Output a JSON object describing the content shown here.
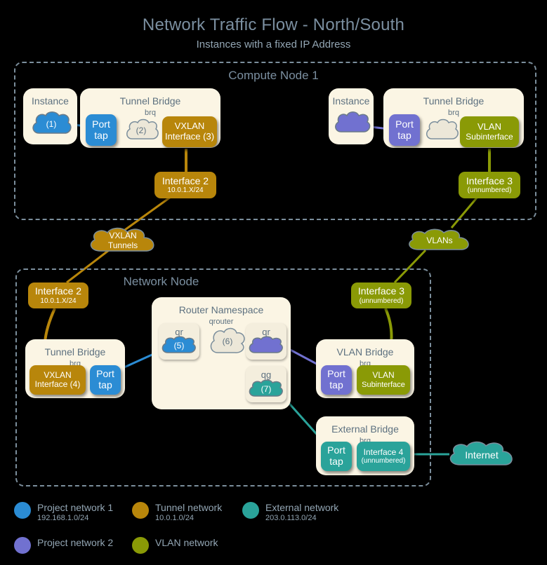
{
  "title": "Network Traffic Flow - North/South",
  "subtitle": "Instances with a fixed IP Address",
  "colors": {
    "project1": "#2b8cd4",
    "project2": "#7171d0",
    "tunnel": "#b8860b",
    "vlan": "#8a9a06",
    "external": "#2aa39a",
    "panel": "#fbf5e4",
    "cloud_neutral": "#ece7d8",
    "border": "#7b8e9c",
    "background": "#000000"
  },
  "zones": {
    "compute": {
      "title": "Compute Node 1"
    },
    "network": {
      "title": "Network Node"
    }
  },
  "compute_left": {
    "instance_panel": {
      "title": "Instance"
    },
    "instance_cloud": {
      "label": "(1)"
    },
    "bridge_panel": {
      "title": "Tunnel Bridge",
      "subtitle": "brq"
    },
    "port_tap": {
      "l1": "Port",
      "l2": "tap"
    },
    "bridge_cloud": {
      "label": "(2)"
    },
    "vxlan_iface": {
      "l1": "VXLAN",
      "l2": "Interface (3)"
    },
    "interface2": {
      "l1": "Interface 2",
      "l2": "10.0.1.X/24"
    }
  },
  "compute_right": {
    "instance_panel": {
      "title": "Instance"
    },
    "bridge_panel": {
      "title": "Tunnel Bridge",
      "subtitle": "brq"
    },
    "port_tap": {
      "l1": "Port",
      "l2": "tap"
    },
    "vlan_sub": {
      "l1": "VLAN",
      "l2": "Subinterface"
    },
    "interface3": {
      "l1": "Interface 3",
      "l2": "(unnumbered)"
    }
  },
  "transit": {
    "vxlan_cloud": {
      "l1": "VXLAN",
      "l2": "Tunnels"
    },
    "vlan_cloud": {
      "l1": "VLANs"
    }
  },
  "network_node": {
    "interface2": {
      "l1": "Interface 2",
      "l2": "10.0.1.X/24"
    },
    "interface3": {
      "l1": "Interface 3",
      "l2": "(unnumbered)"
    },
    "tunnel_bridge": {
      "title": "Tunnel Bridge",
      "subtitle": "brq"
    },
    "tunnel_vxlan_iface": {
      "l1": "VXLAN",
      "l2": "Interface (4)"
    },
    "tunnel_port_tap": {
      "l1": "Port",
      "l2": "tap"
    },
    "router_ns": {
      "title": "Router Namespace",
      "subtitle": "qrouter"
    },
    "qr_left": {
      "label": "qr",
      "cloud": "(5)"
    },
    "router_cloud": {
      "label": "(6)"
    },
    "qr_right": {
      "label": "qr",
      "cloud": ""
    },
    "qg": {
      "label": "qg",
      "cloud": "(7)"
    },
    "vlan_bridge": {
      "title": "VLAN Bridge",
      "subtitle": "brq"
    },
    "vlan_port_tap": {
      "l1": "Port",
      "l2": "tap"
    },
    "vlan_sub": {
      "l1": "VLAN",
      "l2": "Subinterface"
    },
    "external_bridge": {
      "title": "External Bridge",
      "subtitle": "brq"
    },
    "external_port_tap": {
      "l1": "Port",
      "l2": "tap"
    },
    "interface4": {
      "l1": "Interface 4",
      "l2": "(unnumbered)"
    }
  },
  "internet": {
    "label": "Internet"
  },
  "legend": [
    {
      "color": "#2b8cd4",
      "name": "Project network 1",
      "subnet": "192.168.1.0/24"
    },
    {
      "color": "#7171d0",
      "name": "Project network 2",
      "subnet": ""
    },
    {
      "color": "#b8860b",
      "name": "Tunnel network",
      "subnet": "10.0.1.0/24"
    },
    {
      "color": "#8a9a06",
      "name": "VLAN network",
      "subnet": ""
    },
    {
      "color": "#2aa39a",
      "name": "External network",
      "subnet": "203.0.113.0/24"
    }
  ]
}
